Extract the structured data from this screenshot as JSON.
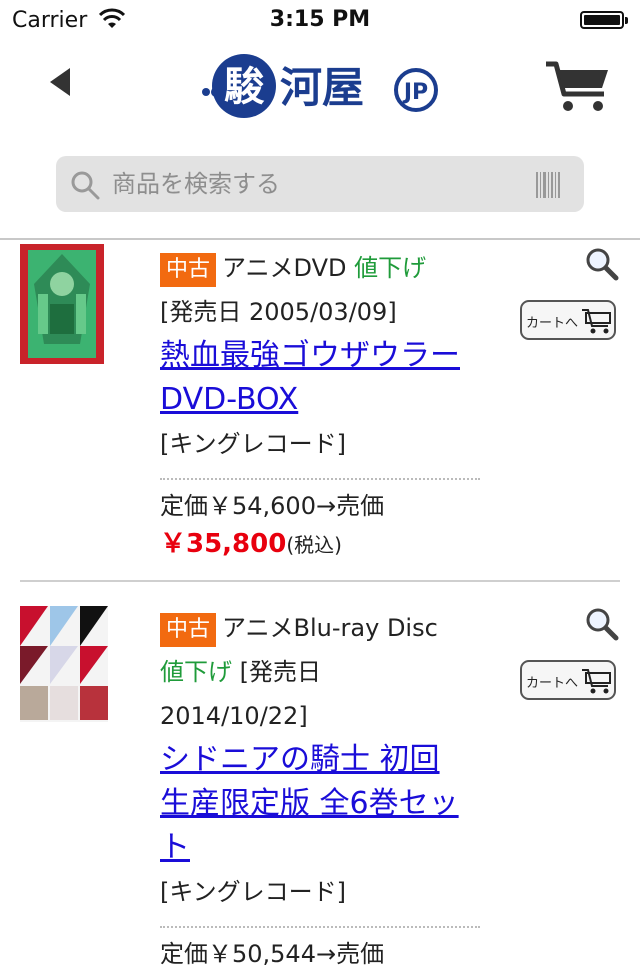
{
  "status_bar": {
    "carrier": "Carrier",
    "time": "3:15 PM"
  },
  "header": {
    "logo_text": "駿河屋",
    "logo_suffix": "JP"
  },
  "search": {
    "placeholder": "商品を検索する"
  },
  "products": [
    {
      "condition_badge": "中古",
      "category": "アニメDVD",
      "sale_label": "値下げ",
      "release": "[発売日 2005/03/09]",
      "title_line1": "熱血最強ゴウザウラー",
      "title_line2": "DVD-BOX",
      "maker": "[キングレコード]",
      "list_price_text": "定価￥54,600→売価",
      "price": "￥35,800",
      "tax_note": "(税込)",
      "cart_button_label": "カートへ"
    },
    {
      "condition_badge": "中古",
      "category": "アニメBlu-ray Disc",
      "sale_label": "値下げ",
      "release_prefix": "[発売日",
      "release_date": "2014/10/22]",
      "title_line1": "シドニアの騎士 初回",
      "title_line2": "生産限定版 全6巻セッ",
      "title_line3": "ト",
      "maker": "[キングレコード]",
      "list_price_text": "定価￥50,544→売価",
      "cart_button_label": "カートへ"
    }
  ],
  "colors": {
    "badge": "#f26a10",
    "sale": "#1f9b3a",
    "link": "#1a0dd8",
    "price": "#e8000e",
    "logo": "#1b3d8f"
  }
}
